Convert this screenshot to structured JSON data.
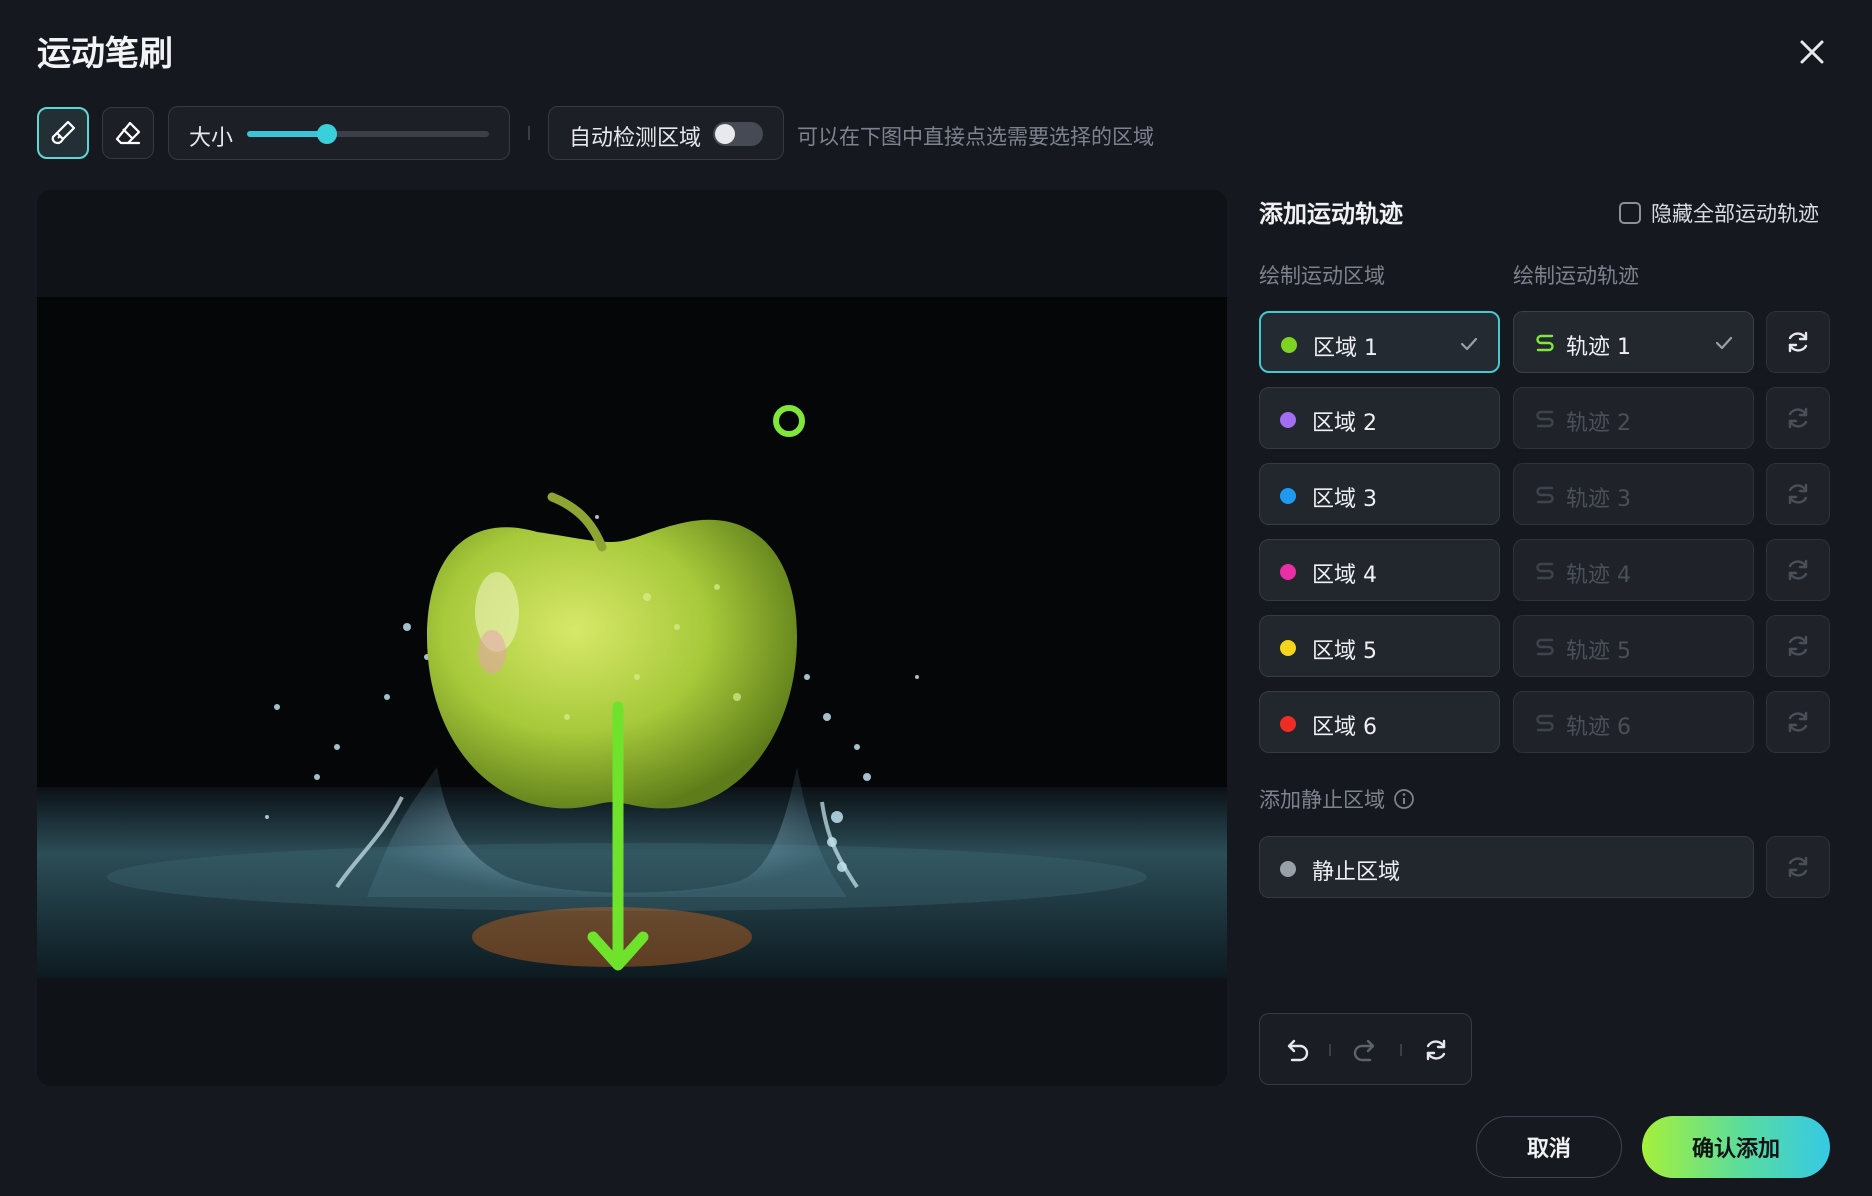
{
  "dialog": {
    "title": "运动笔刷"
  },
  "toolbar": {
    "size_label": "大小",
    "size_value_fraction": 0.33,
    "auto_detect_label": "自动检测区域",
    "auto_detect_on": false,
    "hint": "可以在下图中直接点选需要选择的区域"
  },
  "panel": {
    "title": "添加运动轨迹",
    "hide_all_label": "隐藏全部运动轨迹",
    "col_region": "绘制运动区域",
    "col_track": "绘制运动轨迹",
    "regions": [
      {
        "label": "区域 1",
        "color": "#7ed321",
        "track": "轨迹 1",
        "selected": true
      },
      {
        "label": "区域 2",
        "color": "#a16ef0",
        "track": "轨迹 2",
        "selected": false
      },
      {
        "label": "区域 3",
        "color": "#1e9bf0",
        "track": "轨迹 3",
        "selected": false
      },
      {
        "label": "区域 4",
        "color": "#ea2fa6",
        "track": "轨迹 4",
        "selected": false
      },
      {
        "label": "区域 5",
        "color": "#f5d51b",
        "track": "轨迹 5",
        "selected": false
      },
      {
        "label": "区域 6",
        "color": "#ee2b24",
        "track": "轨迹 6",
        "selected": false
      }
    ],
    "static_head": "添加静止区域",
    "static_label": "静止区域",
    "static_color": "#9aa0a8"
  },
  "actions": {
    "cancel": "取消",
    "confirm": "确认添加"
  },
  "colors": {
    "accent": "#47c7d2",
    "trajectory": "#7ee73a"
  }
}
